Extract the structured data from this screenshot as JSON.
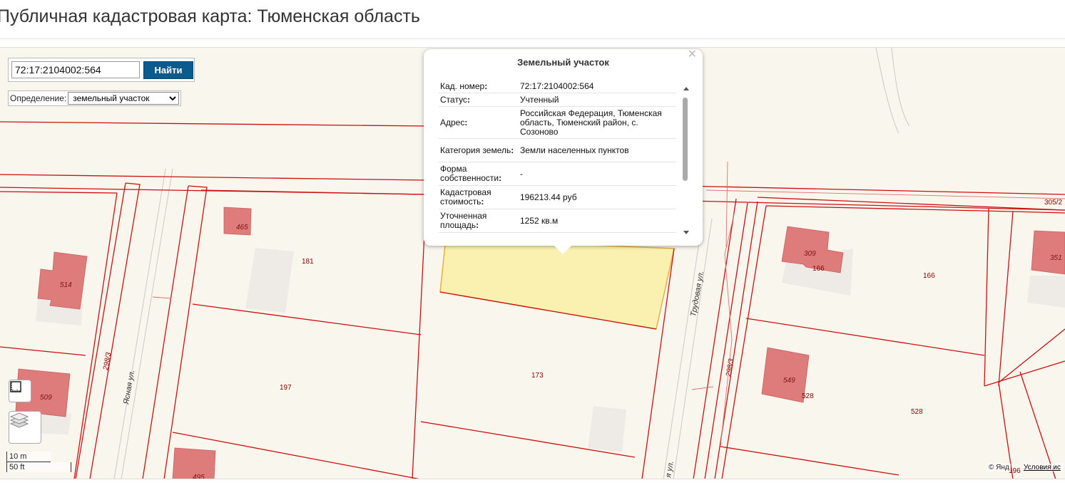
{
  "page": {
    "title": "Публичная кадастровая карта: Тюменская область"
  },
  "search": {
    "value": "72:17:2104002:564",
    "button_label": "Найти"
  },
  "definition": {
    "label": "Определение:",
    "selected": "земельный участок"
  },
  "popup": {
    "title": "Земельный участок",
    "close_icon": "close-icon",
    "rows": [
      {
        "key": "Кад. номер",
        "value": "72:17:2104002:564"
      },
      {
        "key": "Статус",
        "value": "Учтенный"
      },
      {
        "key": "Адрес",
        "value": "Российская Федерация, Тюменская область, Тюменский район, с. Созоново"
      },
      {
        "key": "Категория земель",
        "value": "Земли населенных пунктов"
      },
      {
        "key": "Форма собственности",
        "value": "-"
      },
      {
        "key": "Кадастровая стоимость",
        "value": "196213.44 руб"
      },
      {
        "key": "Уточненная площадь",
        "value": "1252 кв.м"
      }
    ]
  },
  "map": {
    "parcel_labels": [
      "181",
      "197",
      "173",
      "166",
      "166",
      "528",
      "528",
      "196",
      "305/2"
    ],
    "building_labels": [
      "465",
      "514",
      "509",
      "495",
      "309",
      "549",
      "351"
    ],
    "street_labels": [
      "Ясная ул.",
      "Трудовая ул.",
      "298/3",
      "298/3",
      "я ул."
    ],
    "colors": {
      "parcel_line": "#cc1010",
      "building": "#de7b7b",
      "selected": "#faf1b0",
      "background": "#f9f6ee"
    }
  },
  "controls": {
    "ruler_icon": "ruler-icon",
    "layers_icon": "layers-icon"
  },
  "scale": {
    "metric": "10 m",
    "imperial": "50 ft"
  },
  "attribution": {
    "copyright": "© Янд",
    "terms": "Условия ис"
  }
}
